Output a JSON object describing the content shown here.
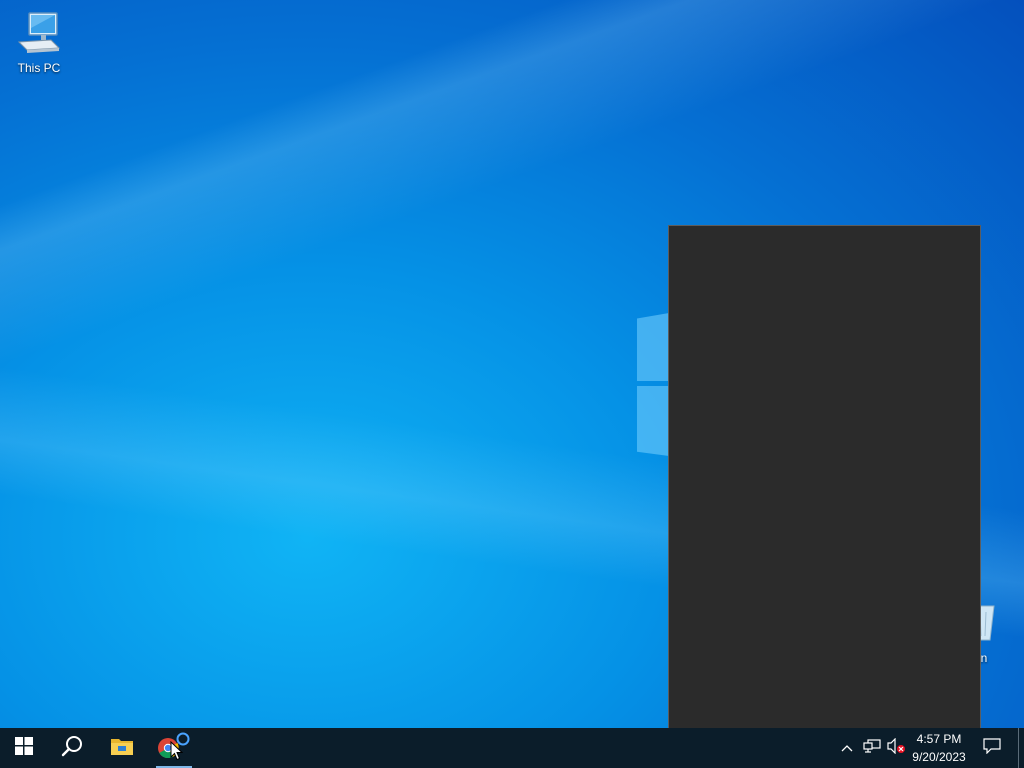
{
  "desktop": {
    "icons": [
      {
        "label": "This PC",
        "icon": "computer-icon"
      },
      {
        "label": "e Bin",
        "icon": "recycle-bin-icon"
      }
    ]
  },
  "flyout": {
    "background": "#2b2b2b"
  },
  "taskbar": {
    "background": "#0b1d2a",
    "buttons": [
      {
        "name": "Start",
        "icon": "windows-logo-icon"
      },
      {
        "name": "Search",
        "icon": "search-icon"
      },
      {
        "name": "File Explorer",
        "icon": "folder-icon"
      },
      {
        "name": "Google Chrome",
        "icon": "chrome-icon"
      }
    ],
    "tray": {
      "icons": [
        "chevron-up-icon",
        "network-icon",
        "volume-muted-icon"
      ],
      "time": "4:57 PM",
      "date": "9/20/2023",
      "notification_icon": "notification-icon"
    }
  },
  "colors": {
    "wallpaper_accent": "#0592e6",
    "taskbar": "#0b1d2a",
    "flyout": "#2b2b2b"
  }
}
